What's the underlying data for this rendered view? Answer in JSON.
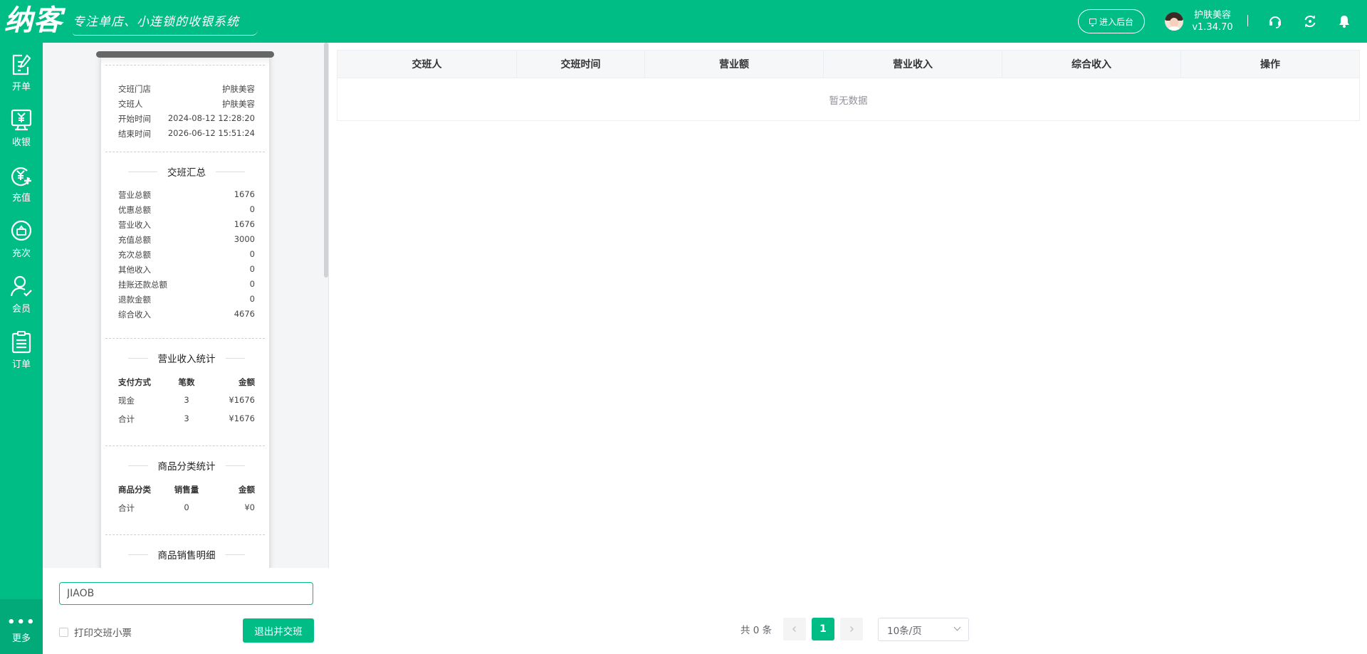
{
  "header": {
    "logo": "纳客",
    "slogan": "专注单店、小连锁的收银系统",
    "admin_button": "进入后台",
    "user_name": "护肤美容",
    "version": "v1.34.70",
    "brand_color": "#00bd86",
    "icons": [
      "headset-icon",
      "sync-icon",
      "bell-icon"
    ]
  },
  "sidebar": {
    "items": [
      {
        "label": "开单",
        "icon": "edit-order-icon"
      },
      {
        "label": "收银",
        "icon": "cashier-icon"
      },
      {
        "label": "充值",
        "icon": "recharge-icon"
      },
      {
        "label": "充次",
        "icon": "recharge-times-icon"
      },
      {
        "label": "会员",
        "icon": "member-icon"
      },
      {
        "label": "订单",
        "icon": "order-icon"
      }
    ],
    "more_label": "更多"
  },
  "receipt": {
    "info": [
      {
        "label": "交班门店",
        "value": "护肤美容"
      },
      {
        "label": "交班人",
        "value": "护肤美容"
      },
      {
        "label": "开始时间",
        "value": "2024-08-12 12:28:20"
      },
      {
        "label": "结束时间",
        "value": "2026-06-12 15:51:24"
      }
    ],
    "summary_title": "交班汇总",
    "summary": [
      {
        "label": "营业总额",
        "value": "1676"
      },
      {
        "label": "优惠总额",
        "value": "0"
      },
      {
        "label": "营业收入",
        "value": "1676"
      },
      {
        "label": "充值总额",
        "value": "3000"
      },
      {
        "label": "充次总额",
        "value": "0"
      },
      {
        "label": "其他收入",
        "value": "0"
      },
      {
        "label": "挂账还款总额",
        "value": "0"
      },
      {
        "label": "退款金额",
        "value": "0"
      },
      {
        "label": "综合收入",
        "value": "4676"
      }
    ],
    "income_title": "营业收入统计",
    "income_headers": [
      "支付方式",
      "笔数",
      "金额"
    ],
    "income_rows": [
      [
        "现金",
        "3",
        "¥1676"
      ],
      [
        "合计",
        "3",
        "¥1676"
      ]
    ],
    "category_title": "商品分类统计",
    "category_headers": [
      "商品分类",
      "销售量",
      "金额"
    ],
    "category_rows": [
      [
        "合计",
        "0",
        "¥0"
      ]
    ],
    "detail_title": "商品销售明细"
  },
  "form": {
    "code_value": "JIAOB",
    "print_label": "打印交班小票",
    "print_checked": false,
    "submit_label": "退出并交班"
  },
  "table": {
    "columns": [
      "交班人",
      "交班时间",
      "营业额",
      "营业收入",
      "综合收入",
      "操作"
    ],
    "empty_text": "暂无数据"
  },
  "pagination": {
    "total_text": "共 0 条",
    "current_page": "1",
    "page_size": "10条/页"
  }
}
